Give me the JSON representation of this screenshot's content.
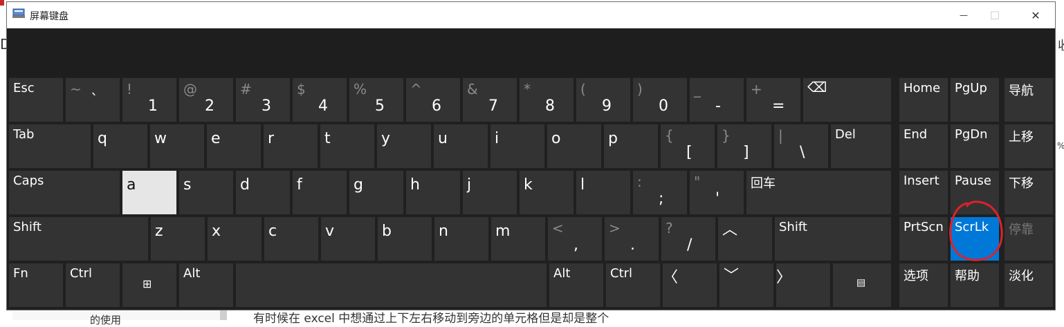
{
  "window": {
    "title": "屏幕键盘",
    "minimize": "—",
    "maximize": "☐",
    "close": "✕"
  },
  "background": {
    "left_letter": "D",
    "right_letter": "收",
    "right_percent": "%",
    "bottom_left_text": "的使用",
    "bottom_text": "有时候在 excel 中想通过上下左右移动到旁边的单元格但是却是整个"
  },
  "keys": {
    "esc": "Esc",
    "tilde_shift": "~",
    "tilde_main": "`",
    "n1_shift": "!",
    "n1_main": "1",
    "n2_shift": "@",
    "n2_main": "2",
    "n3_shift": "#",
    "n3_main": "3",
    "n4_shift": "$",
    "n4_main": "4",
    "n5_shift": "%",
    "n5_main": "5",
    "n6_shift": "^",
    "n6_main": "6",
    "n7_shift": "&",
    "n7_main": "7",
    "n8_shift": "*",
    "n8_main": "8",
    "n9_shift": "(",
    "n9_main": "9",
    "n0_shift": ")",
    "n0_main": "0",
    "minus_shift": "_",
    "minus_main": "-",
    "equal_shift": "+",
    "equal_main": "=",
    "backspace": "⌫",
    "home": "Home",
    "pgup": "PgUp",
    "nav": "导航",
    "tab": "Tab",
    "q": "q",
    "w": "w",
    "e": "e",
    "r": "r",
    "t": "t",
    "y": "y",
    "u": "u",
    "i": "i",
    "o": "o",
    "p": "p",
    "lbrace_shift": "{",
    "lbrace_main": "[",
    "rbrace_shift": "}",
    "rbrace_main": "]",
    "pipe_shift": "|",
    "pipe_main": "\\",
    "del": "Del",
    "end": "End",
    "pgdn": "PgDn",
    "moveup": "上移",
    "caps": "Caps",
    "a": "a",
    "s": "s",
    "d": "d",
    "f": "f",
    "g": "g",
    "h": "h",
    "j": "j",
    "k": "k",
    "l": "l",
    "semi_shift": ":",
    "semi_main": ";",
    "quote_shift": "\"",
    "quote_main": "'",
    "enter": "回车",
    "insert": "Insert",
    "pause": "Pause",
    "movedown": "下移",
    "shift_left": "Shift",
    "z": "z",
    "x": "x",
    "c": "c",
    "v": "v",
    "b": "b",
    "n": "n",
    "m": "m",
    "comma_shift": "<",
    "comma_main": ",",
    "period_shift": ">",
    "period_main": ".",
    "slash_shift": "?",
    "slash_main": "/",
    "up": "︿",
    "shift_right": "Shift",
    "prtscn": "PrtScn",
    "scrlk": "ScrLk",
    "dock": "停靠",
    "fn": "Fn",
    "ctrl_left": "Ctrl",
    "win": "⊞",
    "alt_left": "Alt",
    "alt_right": "Alt",
    "ctrl_right": "Ctrl",
    "left": "〈",
    "down": "﹀",
    "right": "〉",
    "menu": "▤",
    "options": "选项",
    "help": "帮助",
    "fade": "淡化"
  },
  "colors": {
    "key_bg": "#333333",
    "pressed_bg": "#e6e6e6",
    "active_bg": "#0078d7",
    "annotation": "#e0212a"
  }
}
